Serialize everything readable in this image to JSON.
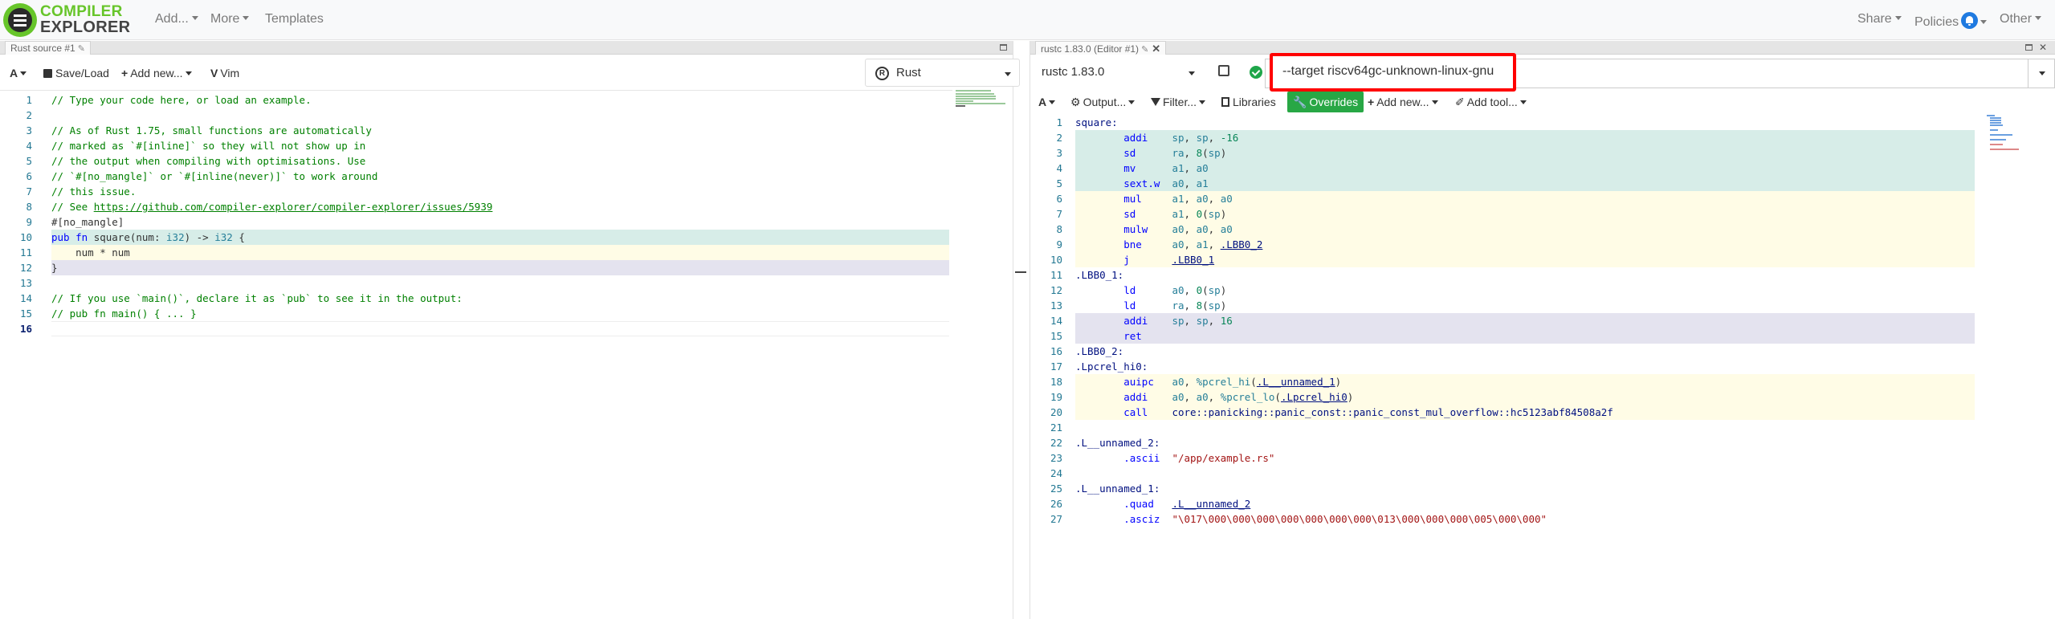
{
  "brand": {
    "line1": "COMPILER",
    "line2": "EXPLORER"
  },
  "nav": {
    "add": "Add...",
    "more": "More",
    "templates": "Templates",
    "share": "Share",
    "policies": "Policies",
    "other": "Other"
  },
  "source_pane": {
    "tab_title": "Rust source #1",
    "toolbar": {
      "font_size": "A",
      "save_load": "Save/Load",
      "add_new": "Add new...",
      "vim": "Vim",
      "language": "Rust"
    },
    "lines": [
      "// Type your code here, or load an example.",
      "",
      "// As of Rust 1.75, small functions are automatically",
      "// marked as `#[inline]` so they will not show up in",
      "// the output when compiling with optimisations. Use",
      "// `#[no_mangle]` or `#[inline(never)]` to work around",
      "// this issue.",
      "// See https://github.com/compiler-explorer/compiler-explorer/issues/5939",
      "#[no_mangle]",
      "pub fn square(num: i32) -> i32 {",
      "    num * num",
      "}",
      "",
      "// If you use `main()`, declare it as `pub` to see it in the output:",
      "// pub fn main() { ... }",
      ""
    ],
    "link_text": "https://github.com/compiler-explorer/compiler-explorer/issues/5939"
  },
  "compiler_pane": {
    "tab_title": "rustc 1.83.0 (Editor #1)",
    "compiler": "rustc 1.83.0",
    "options_value": "--target riscv64gc-unknown-linux-gnu",
    "toolbar": {
      "font_size": "A",
      "output": "Output...",
      "filter": "Filter...",
      "libraries": "Libraries",
      "overrides": "Overrides",
      "add_new": "Add new...",
      "add_tool": "Add tool..."
    },
    "asm": [
      {
        "label": "square:"
      },
      {
        "op": "addi",
        "args": "sp, sp, -16"
      },
      {
        "op": "sd",
        "args": "ra, 8(sp)"
      },
      {
        "op": "mv",
        "args": "a1, a0"
      },
      {
        "op": "sext.w",
        "args": "a0, a1"
      },
      {
        "op": "mul",
        "args": "a1, a0, a0"
      },
      {
        "op": "sd",
        "args": "a1, 0(sp)"
      },
      {
        "op": "mulw",
        "args": "a0, a0, a0"
      },
      {
        "op": "bne",
        "args": "a0, a1, .LBB0_2"
      },
      {
        "op": "j",
        "args": ".LBB0_1"
      },
      {
        "label": ".LBB0_1:"
      },
      {
        "op": "ld",
        "args": "a0, 0(sp)"
      },
      {
        "op": "ld",
        "args": "ra, 8(sp)"
      },
      {
        "op": "addi",
        "args": "sp, sp, 16"
      },
      {
        "op": "ret",
        "args": ""
      },
      {
        "label": ".LBB0_2:"
      },
      {
        "label": ".Lpcrel_hi0:"
      },
      {
        "op": "auipc",
        "args": "a0, %pcrel_hi(.L__unnamed_1)"
      },
      {
        "op": "addi",
        "args": "a0, a0, %pcrel_lo(.Lpcrel_hi0)"
      },
      {
        "op": "call",
        "args": "core::panicking::panic_const::panic_const_mul_overflow::hc5123abf84508a2f"
      },
      {
        "label": ""
      },
      {
        "label": ".L__unnamed_2:"
      },
      {
        "op": ".ascii",
        "args": "\"/app/example.rs\""
      },
      {
        "label": ""
      },
      {
        "label": ".L__unnamed_1:"
      },
      {
        "op": ".quad",
        "args": ".L__unnamed_2"
      },
      {
        "op": ".asciz",
        "args": "\"\\017\\000\\000\\000\\000\\000\\000\\000\\013\\000\\000\\000\\005\\000\\000\""
      }
    ]
  },
  "colors": {
    "accent_green": "#28a745",
    "highlight_red": "#ff0000",
    "bell_blue": "#1f7ae0"
  }
}
